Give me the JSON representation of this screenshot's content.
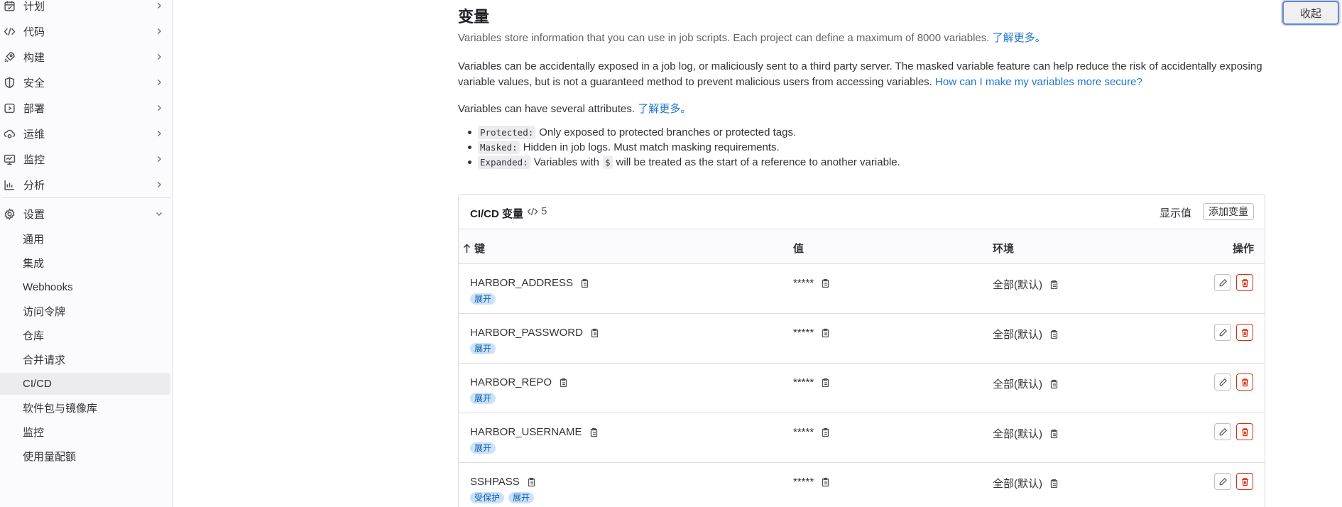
{
  "sidebar": {
    "items": [
      {
        "label": "计划",
        "icon": "calendar-icon"
      },
      {
        "label": "代码",
        "icon": "code-icon"
      },
      {
        "label": "构建",
        "icon": "rocket-icon"
      },
      {
        "label": "安全",
        "icon": "shield-icon"
      },
      {
        "label": "部署",
        "icon": "deploy-icon"
      },
      {
        "label": "运维",
        "icon": "cloud-gear-icon"
      },
      {
        "label": "监控",
        "icon": "monitor-icon"
      },
      {
        "label": "分析",
        "icon": "chart-icon"
      },
      {
        "label": "设置",
        "icon": "gear-icon"
      }
    ],
    "settings_sub": [
      {
        "label": "通用"
      },
      {
        "label": "集成"
      },
      {
        "label": "Webhooks"
      },
      {
        "label": "访问令牌"
      },
      {
        "label": "仓库"
      },
      {
        "label": "合并请求"
      },
      {
        "label": "CI/CD"
      },
      {
        "label": "软件包与镜像库"
      },
      {
        "label": "监控"
      },
      {
        "label": "使用量配额"
      }
    ],
    "active_sub": "CI/CD"
  },
  "collapse_label": "收起",
  "section": {
    "title": "变量",
    "intro": "Variables store information that you can use in job scripts. Each project can define a maximum of 8000 variables.",
    "intro_link": "了解更多。",
    "warning": "Variables can be accidentally exposed in a job log, or maliciously sent to a third party server. The masked variable feature can help reduce the risk of accidentally exposing variable values, but is not a guaranteed method to prevent malicious users from accessing variables.",
    "warning_link": "How can I make my variables more secure?",
    "attrs_text": "Variables can have several attributes.",
    "attrs_link": "了解更多。",
    "attributes": [
      {
        "code": "Protected:",
        "text": "Only exposed to protected branches or protected tags."
      },
      {
        "code": "Masked:",
        "text": "Hidden in job logs. Must match masking requirements."
      },
      {
        "code": "Expanded:",
        "text_before": "Variables with",
        "code2": "$",
        "text_after": "will be treated as the start of a reference to another variable."
      }
    ]
  },
  "card": {
    "title": "CI/CD 变量",
    "count": "5",
    "show_values": "显示值",
    "add_variable": "添加变量",
    "columns": {
      "key": "键",
      "value": "值",
      "env": "环境",
      "actions": "操作"
    },
    "rows": [
      {
        "key": "HARBOR_ADDRESS",
        "value": "*****",
        "env": "全部(默认)",
        "badges": [
          "展开"
        ]
      },
      {
        "key": "HARBOR_PASSWORD",
        "value": "*****",
        "env": "全部(默认)",
        "badges": [
          "展开"
        ]
      },
      {
        "key": "HARBOR_REPO",
        "value": "*****",
        "env": "全部(默认)",
        "badges": [
          "展开"
        ]
      },
      {
        "key": "HARBOR_USERNAME",
        "value": "*****",
        "env": "全部(默认)",
        "badges": [
          "展开"
        ]
      },
      {
        "key": "SSHPASS",
        "value": "*****",
        "env": "全部(默认)",
        "badges": [
          "受保护",
          "展开"
        ]
      }
    ]
  }
}
